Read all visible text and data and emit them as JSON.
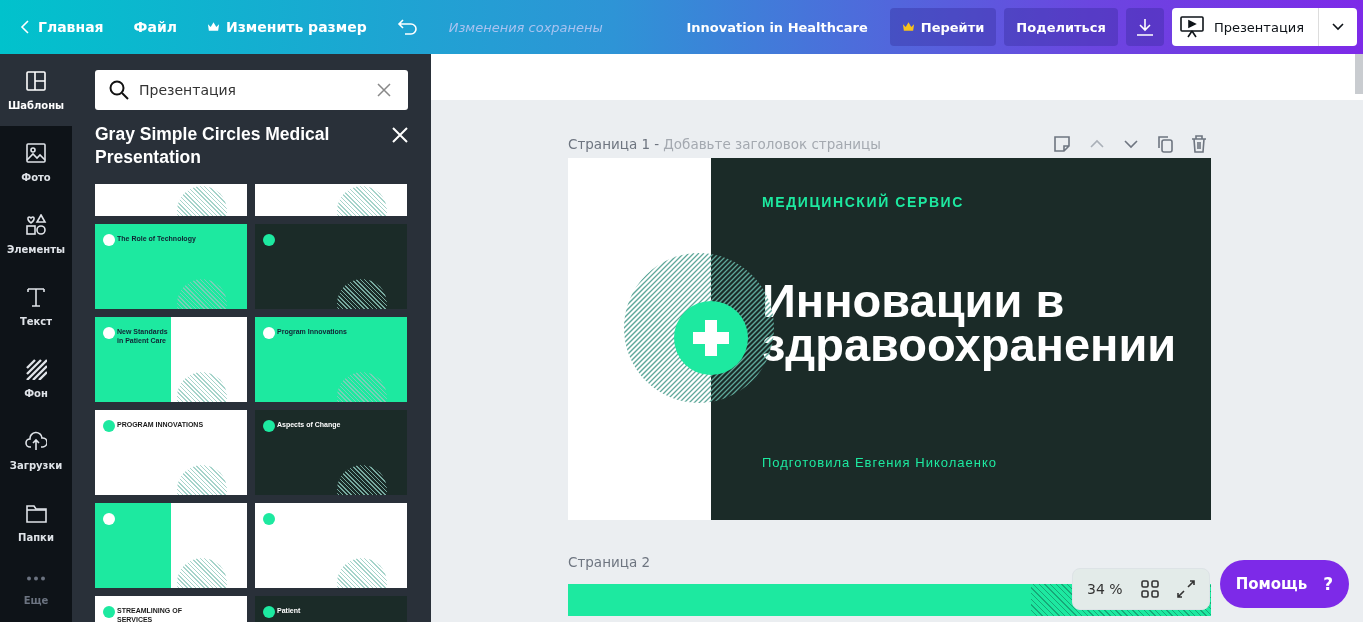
{
  "topbar": {
    "back": "Главная",
    "menu": [
      {
        "label": "Файл",
        "premium": false
      },
      {
        "label": "Изменить размер",
        "premium": true
      }
    ],
    "save_status": "Изменения сохранены",
    "doc_title": "Innovation in Healthcare",
    "buttons": [
      {
        "kind": "premium",
        "label": "Перейти"
      },
      {
        "kind": "text",
        "label": "Поделиться"
      },
      {
        "kind": "download"
      },
      {
        "kind": "present",
        "label": "Презентация"
      }
    ]
  },
  "sidebar": {
    "items": [
      {
        "kind": "templates",
        "label": "Шаблоны",
        "selected": true
      },
      {
        "kind": "photo",
        "label": "Фото",
        "selected": false
      },
      {
        "kind": "elements",
        "label": "Элементы",
        "selected": false
      },
      {
        "kind": "text",
        "label": "Текст",
        "selected": false
      },
      {
        "kind": "background",
        "label": "Фон",
        "selected": false
      },
      {
        "kind": "uploads",
        "label": "Загрузки",
        "selected": false
      },
      {
        "kind": "folder",
        "label": "Папки",
        "selected": false
      },
      {
        "kind": "more",
        "label": "Еще",
        "selected": false,
        "disabled": true
      }
    ]
  },
  "panel": {
    "search": {
      "value": "Презентация"
    },
    "title": "Gray Simple Circles Medical Presentation",
    "templates": [
      {
        "kind": "white"
      },
      {
        "kind": "white"
      },
      {
        "kind": "green",
        "title": "The Role of Technology"
      },
      {
        "kind": "dark"
      },
      {
        "kind": "split",
        "title": "New Standards in Patient Care"
      },
      {
        "kind": "green",
        "title": "Program Innovations"
      },
      {
        "kind": "white",
        "title": "PROGRAM INNOVATIONS"
      },
      {
        "kind": "dark",
        "title": "Aspects of Change"
      },
      {
        "kind": "split"
      },
      {
        "kind": "white"
      },
      {
        "kind": "white",
        "title": "STREAMLINING OF SERVICES"
      },
      {
        "kind": "dark",
        "title": "Patient"
      }
    ]
  },
  "pages": [
    {
      "label": "Страница 1 -",
      "placeholder": "Добавьте заголовок страницы",
      "slide": {
        "eyebrow": "МЕДИЦИНСКИЙ СЕРВИС",
        "title": "Инновации в здравоохранении",
        "subtitle": "Подготовила Евгения Николаенко"
      }
    },
    {
      "label": "Страница 2"
    }
  ],
  "zoom": {
    "value": "34 %"
  },
  "help": {
    "label": "Помощь",
    "mark": "?"
  }
}
